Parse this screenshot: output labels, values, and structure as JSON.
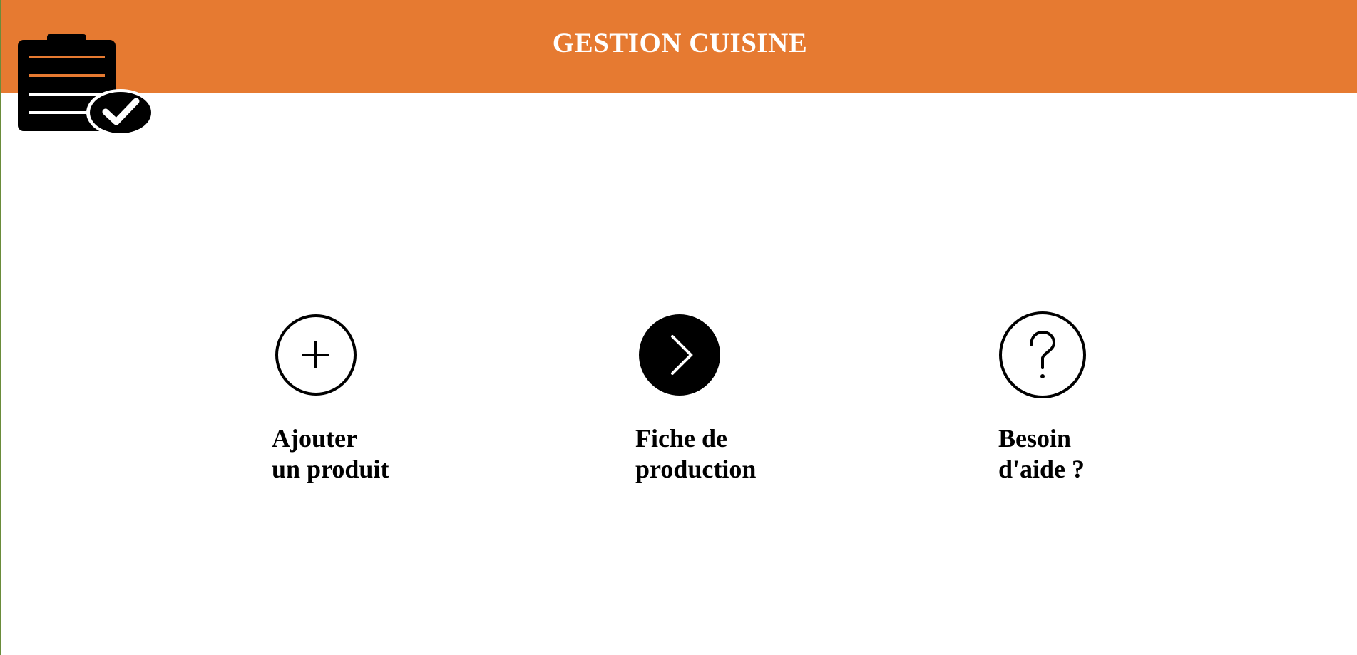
{
  "header": {
    "title": "GESTION CUISINE",
    "background_color": "#e67a31",
    "title_color": "#ffffff",
    "logo_icon": "clipboard-check-icon"
  },
  "menu": {
    "items": [
      {
        "id": "add",
        "icon": "plus-circle-icon",
        "line1": "Ajouter",
        "line2": "un produit"
      },
      {
        "id": "production",
        "icon": "chevron-right-circle-icon",
        "line1": "Fiche de",
        "line2": "production"
      },
      {
        "id": "help",
        "icon": "question-circle-icon",
        "line1": "Besoin",
        "line2": "d'aide ?"
      }
    ]
  }
}
